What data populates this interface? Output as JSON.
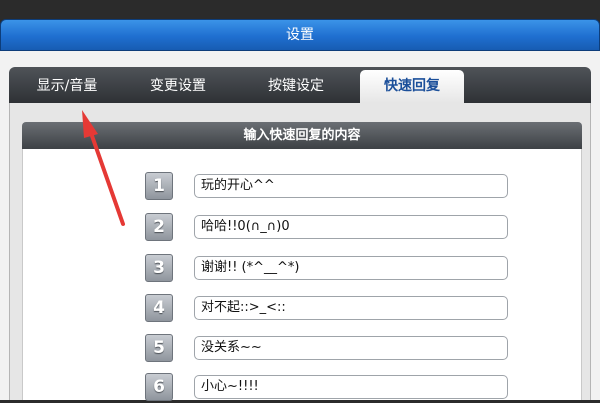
{
  "window": {
    "title": "设置"
  },
  "tabs": [
    {
      "label": "显示/音量"
    },
    {
      "label": "变更设置"
    },
    {
      "label": "按键设定"
    },
    {
      "label": "快速回复"
    }
  ],
  "panel": {
    "heading": "输入快速回复的内容"
  },
  "replies": [
    {
      "number": "1",
      "text": "玩的开心^^"
    },
    {
      "number": "2",
      "text": "哈哈!!0(∩_∩)0"
    },
    {
      "number": "3",
      "text": "谢谢!! (*^__^*)"
    },
    {
      "number": "4",
      "text": "对不起::>_<::"
    },
    {
      "number": "5",
      "text": "没关系~~"
    },
    {
      "number": "6",
      "text": "小心~!!!!"
    }
  ],
  "colors": {
    "accent": "#1f6fd0",
    "arrow": "#e53935"
  }
}
